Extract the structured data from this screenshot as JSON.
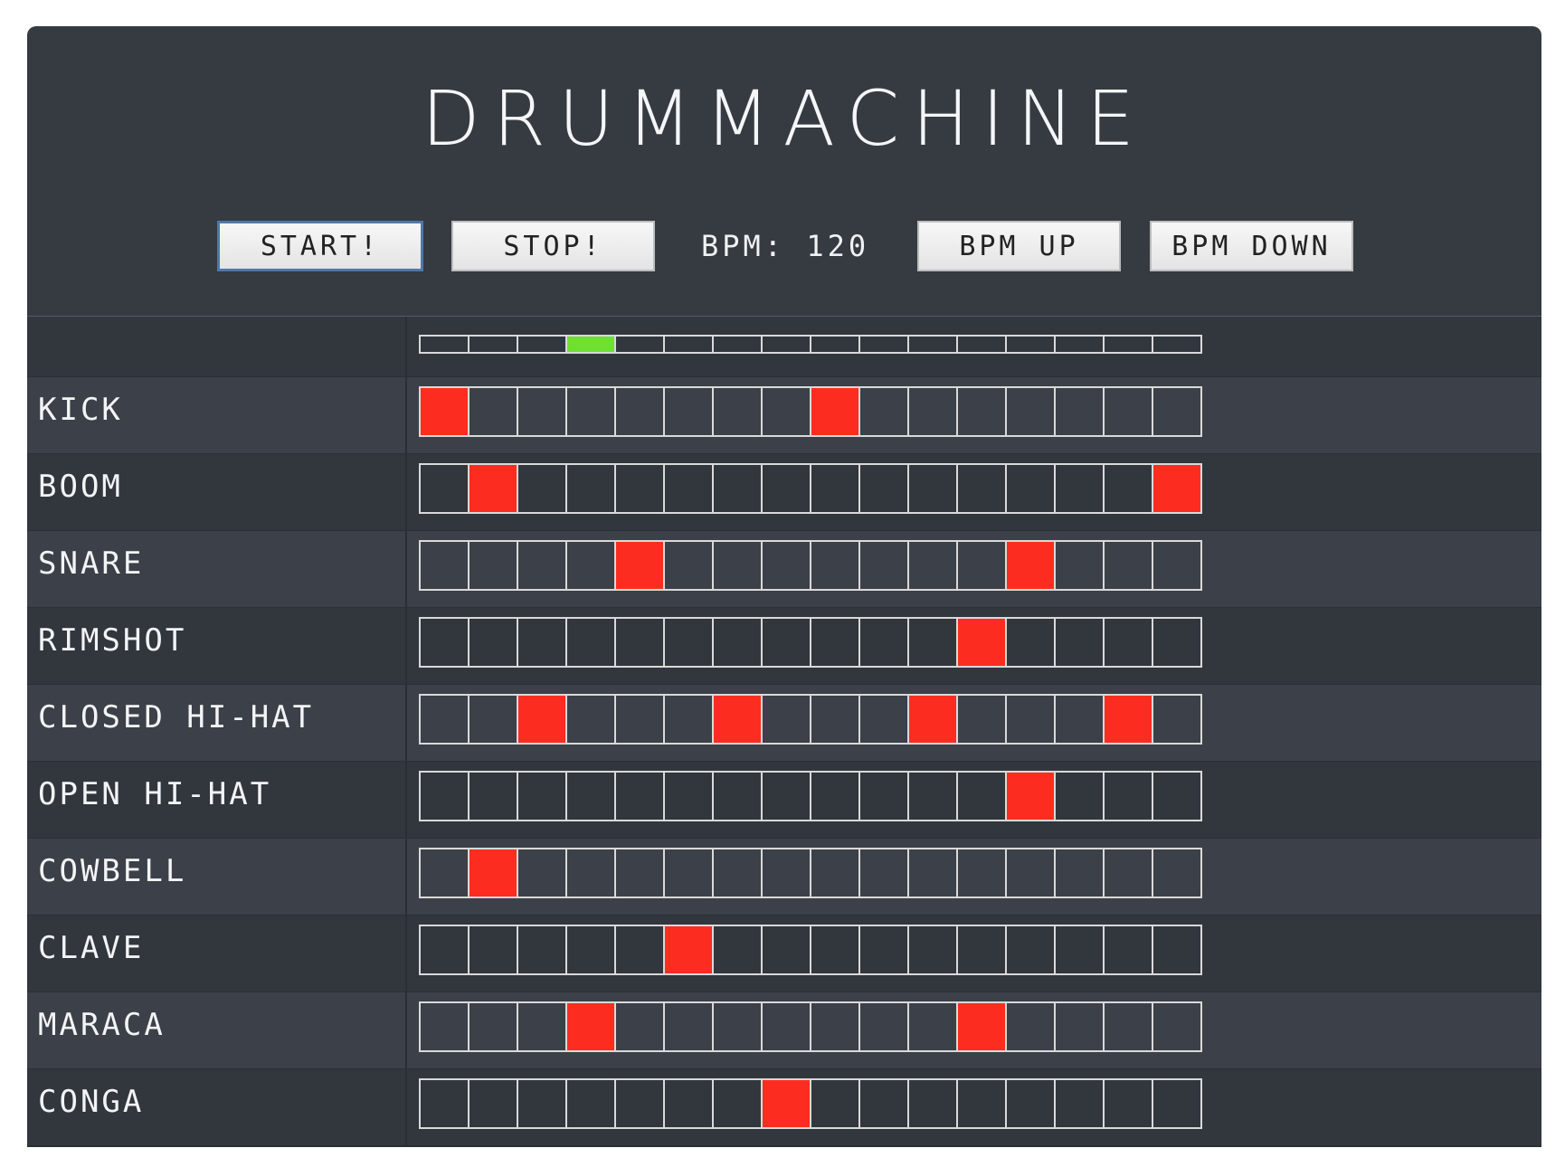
{
  "title": "DRUMMACHINE",
  "controls": {
    "start_label": "START!",
    "stop_label": "STOP!",
    "bpm_text": "BPM: 120",
    "bpm_up_label": "BPM UP",
    "bpm_down_label": "BPM DOWN"
  },
  "playhead": {
    "current_step": 4,
    "total_steps": 16
  },
  "tracks": [
    {
      "name": "KICK",
      "steps": [
        1,
        0,
        0,
        0,
        0,
        0,
        0,
        0,
        1,
        0,
        0,
        0,
        0,
        0,
        0,
        0
      ]
    },
    {
      "name": "BOOM",
      "steps": [
        0,
        1,
        0,
        0,
        0,
        0,
        0,
        0,
        0,
        0,
        0,
        0,
        0,
        0,
        0,
        1
      ]
    },
    {
      "name": "SNARE",
      "steps": [
        0,
        0,
        0,
        0,
        1,
        0,
        0,
        0,
        0,
        0,
        0,
        0,
        1,
        0,
        0,
        0
      ]
    },
    {
      "name": "RIMSHOT",
      "steps": [
        0,
        0,
        0,
        0,
        0,
        0,
        0,
        0,
        0,
        0,
        0,
        1,
        0,
        0,
        0,
        0
      ]
    },
    {
      "name": "CLOSED HI-HAT",
      "steps": [
        0,
        0,
        1,
        0,
        0,
        0,
        1,
        0,
        0,
        0,
        1,
        0,
        0,
        0,
        1,
        0
      ]
    },
    {
      "name": "OPEN HI-HAT",
      "steps": [
        0,
        0,
        0,
        0,
        0,
        0,
        0,
        0,
        0,
        0,
        0,
        0,
        1,
        0,
        0,
        0
      ]
    },
    {
      "name": "COWBELL",
      "steps": [
        0,
        1,
        0,
        0,
        0,
        0,
        0,
        0,
        0,
        0,
        0,
        0,
        0,
        0,
        0,
        0
      ]
    },
    {
      "name": "CLAVE",
      "steps": [
        0,
        0,
        0,
        0,
        0,
        1,
        0,
        0,
        0,
        0,
        0,
        0,
        0,
        0,
        0,
        0
      ]
    },
    {
      "name": "MARACA",
      "steps": [
        0,
        0,
        0,
        1,
        0,
        0,
        0,
        0,
        0,
        0,
        0,
        1,
        0,
        0,
        0,
        0
      ]
    },
    {
      "name": "CONGA",
      "steps": [
        0,
        0,
        0,
        0,
        0,
        0,
        0,
        1,
        0,
        0,
        0,
        0,
        0,
        0,
        0,
        0
      ]
    }
  ],
  "colors": {
    "active_step": "#fc2d20",
    "playhead": "#6fe02f",
    "panel": "#363a41"
  }
}
